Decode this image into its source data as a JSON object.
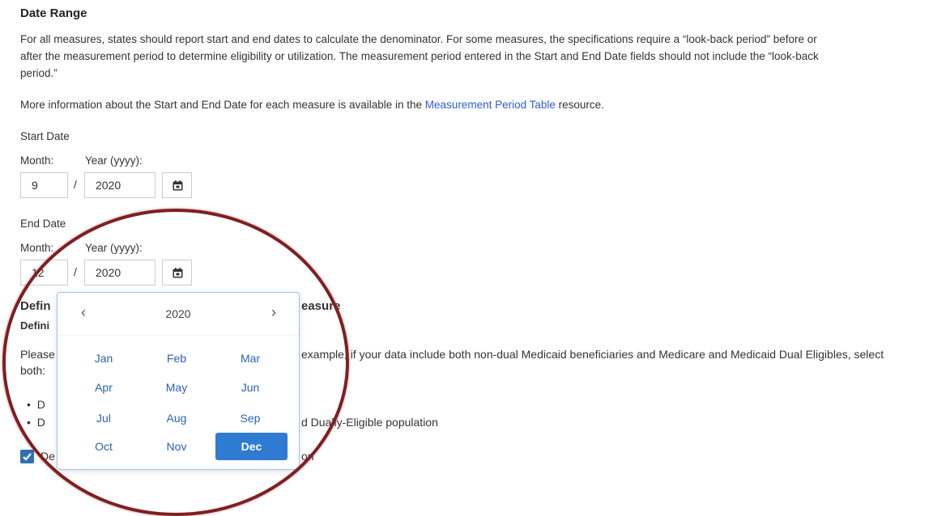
{
  "section": {
    "title": "Date Range",
    "paragraph_lines": [
      "For all measures, states should report start and end dates to calculate the denominator. For some measures, the specifications require a “look-back period” before or",
      "after the measurement period to determine eligibility or utilization. The measurement period entered in the Start and End Date fields should not include the “look-back",
      "period.”"
    ],
    "info_prefix": "More information about the Start and End Date for each measure is available in the ",
    "info_link": "Measurement Period Table",
    "info_suffix": " resource."
  },
  "start_date": {
    "label": "Start Date",
    "month_label": "Month:",
    "year_label": "Year (yyyy):",
    "month_value": "9",
    "separator": "/",
    "year_value": "2020"
  },
  "end_date": {
    "label": "End Date",
    "month_label": "Month:",
    "year_label": "Year (yyyy):",
    "month_value": "12",
    "separator": "/",
    "year_value": "2020"
  },
  "behind": {
    "heading_left": "Defin",
    "heading_right": "easure",
    "subheading_left": "Defini",
    "line1_left": "Please",
    "line1_right": "example, if your data include both non-dual Medicaid beneficiaries and Medicare and Medicaid Dual Eligibles, select",
    "line2": "both:",
    "bullet1_left": "D",
    "bullet2_left": "D",
    "bullet2_right": "d Dually-Eligible population",
    "checkbox_left": "De",
    "checkbox_right": "on"
  },
  "picker": {
    "year": "2020",
    "prev": "‹",
    "next": "›",
    "months": [
      "Jan",
      "Feb",
      "Mar",
      "Apr",
      "May",
      "Jun",
      "Jul",
      "Aug",
      "Sep",
      "Oct",
      "Nov",
      "Dec"
    ],
    "selected": "Dec"
  },
  "colors": {
    "link": "#2f5bd8",
    "month_text": "#2a64ad",
    "selected_bg": "#2f7bd1",
    "lens_border": "#7f1f22"
  },
  "icons": {
    "calendar": "calendar-icon",
    "checkbox": "checkmark-icon"
  }
}
